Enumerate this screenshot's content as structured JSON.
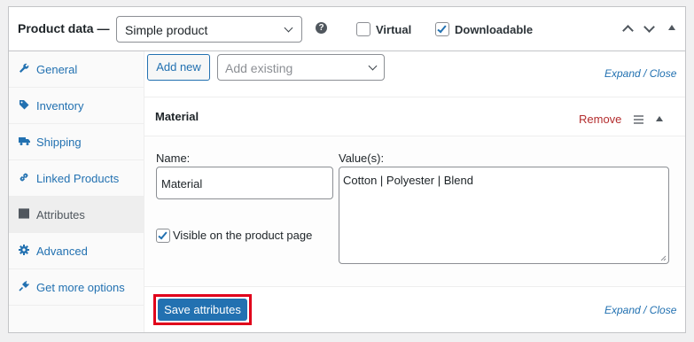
{
  "header": {
    "title": "Product data —",
    "product_type": "Simple product",
    "help_glyph": "?",
    "virtual_label": "Virtual",
    "virtual_checked": false,
    "downloadable_label": "Downloadable",
    "downloadable_checked": true
  },
  "sidebar": {
    "items": [
      {
        "label": "General",
        "icon": "wrench-icon"
      },
      {
        "label": "Inventory",
        "icon": "tag-icon"
      },
      {
        "label": "Shipping",
        "icon": "truck-icon"
      },
      {
        "label": "Linked Products",
        "icon": "link-icon"
      },
      {
        "label": "Attributes",
        "icon": "list-icon",
        "active": true
      },
      {
        "label": "Advanced",
        "icon": "gear-icon"
      },
      {
        "label": "Get more options",
        "icon": "plugin-icon"
      }
    ]
  },
  "toolbar": {
    "add_new_label": "Add new",
    "add_existing_placeholder": "Add existing",
    "expand_close": "Expand / Close"
  },
  "attribute": {
    "name": "Material",
    "remove_label": "Remove",
    "name_label": "Name:",
    "name_value": "Material",
    "values_label": "Value(s):",
    "values_value": "Cotton | Polyester | Blend",
    "visible_label": "Visible on the product page",
    "visible_checked": true
  },
  "footer": {
    "save_label": "Save attributes",
    "expand_close": "Expand / Close"
  },
  "colors": {
    "accent": "#2271b1",
    "remove": "#b32d2e",
    "highlight_border": "#e0001b"
  }
}
